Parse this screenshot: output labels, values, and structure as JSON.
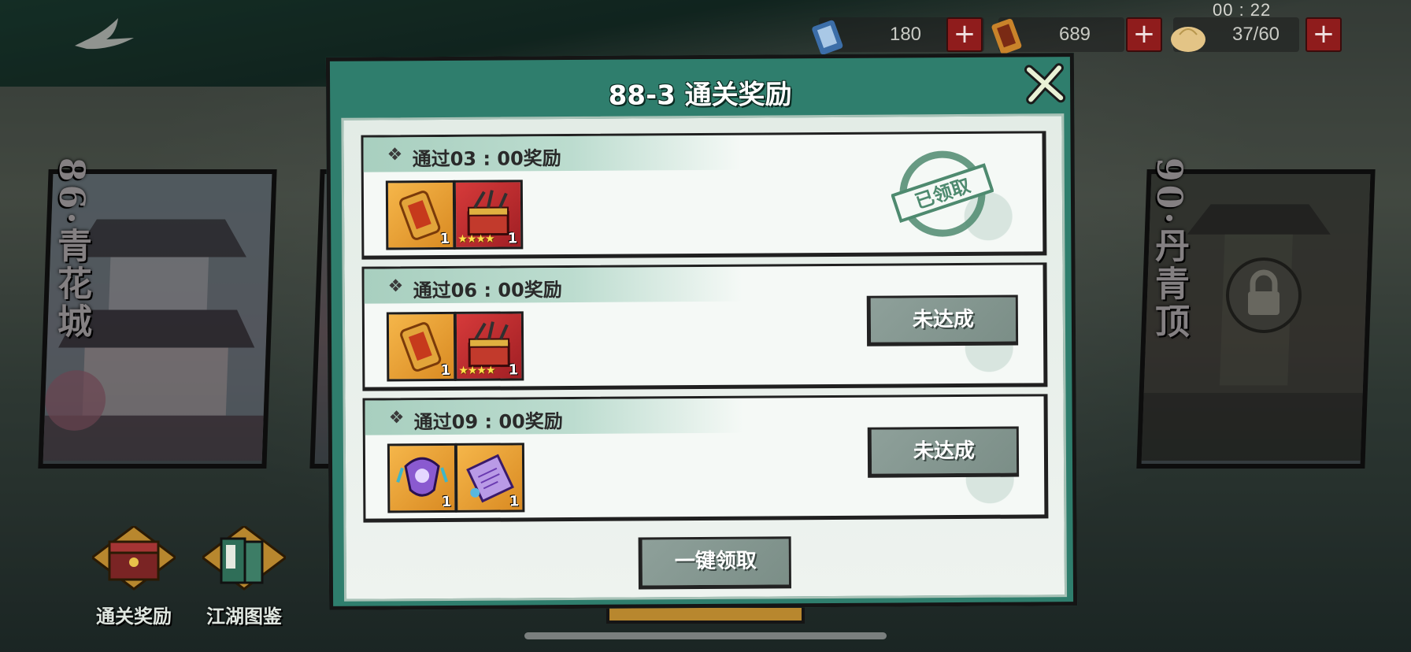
{
  "hud": {
    "timer": "00 : 22",
    "resources": [
      {
        "icon": "stamina-scroll-icon",
        "value": "180"
      },
      {
        "icon": "token-icon",
        "value": "689"
      },
      {
        "icon": "steamed-bun-icon",
        "value": "37/60"
      }
    ],
    "plus_label": "+"
  },
  "levels": {
    "left": {
      "number": "86",
      "title": "青花城"
    },
    "right": {
      "number": "90",
      "title": "丹青顶"
    }
  },
  "bottom_buttons": [
    {
      "icon": "treasure-chest-icon",
      "label": "通关奖励"
    },
    {
      "icon": "books-icon",
      "label": "江湖图鉴"
    }
  ],
  "modal": {
    "title": "88-3 通关奖励",
    "rows": [
      {
        "title": "通过03 : 00奖励",
        "status": "claimed",
        "stamp_text": "已领取",
        "items": [
          {
            "icon": "golden-badge-icon",
            "count": "1",
            "slot_color": "#f5b64a",
            "stars": ""
          },
          {
            "icon": "weapon-chest-icon",
            "count": "1",
            "slot_color": "#d63a3a",
            "stars": "★★★★"
          }
        ]
      },
      {
        "title": "通过06 : 00奖励",
        "status": "unreached",
        "button_label": "未达成",
        "items": [
          {
            "icon": "golden-badge-icon",
            "count": "1",
            "slot_color": "#f5b64a",
            "stars": ""
          },
          {
            "icon": "weapon-chest-icon",
            "count": "1",
            "slot_color": "#d63a3a",
            "stars": "★★★★"
          }
        ]
      },
      {
        "title": "通过09 : 00奖励",
        "status": "unreached",
        "button_label": "未达成",
        "items": [
          {
            "icon": "purple-amulet-icon",
            "count": "1",
            "slot_color": "#f5b64a",
            "stars": ""
          },
          {
            "icon": "purple-scroll-icon",
            "count": "1",
            "slot_color": "#f5b64a",
            "stars": ""
          }
        ]
      }
    ],
    "claim_all_label": "一键领取"
  },
  "colors": {
    "modal_frame": "#2f7e6d",
    "button_gray": "#8ea09a",
    "plus_red": "#8f1c1c",
    "stamp_green": "#4e8a6f"
  }
}
